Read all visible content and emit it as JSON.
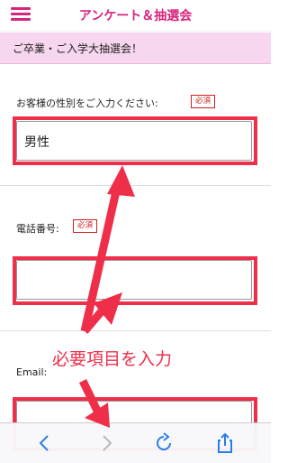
{
  "header": {
    "title": "アンケート＆抽選会",
    "menu_icon": "hamburger-menu-icon",
    "accent": "#d6247d"
  },
  "banner": {
    "text": "ご卒業・ご入学大抽選会！",
    "bg": "#f7d6ef"
  },
  "form": {
    "gender": {
      "label": "お客様の性別をご入力ください:",
      "required": "必須",
      "value": "男性"
    },
    "phone": {
      "label": "電話番号:",
      "required": "必須",
      "value": ""
    },
    "email": {
      "label": "Email:",
      "value": ""
    }
  },
  "annotation": {
    "text": "必要項目を入力",
    "color": "#ef2f4a"
  },
  "toolbar": {
    "icons": [
      "back-arrow-icon",
      "forward-arrow-icon",
      "reload-icon",
      "share-icon"
    ]
  }
}
